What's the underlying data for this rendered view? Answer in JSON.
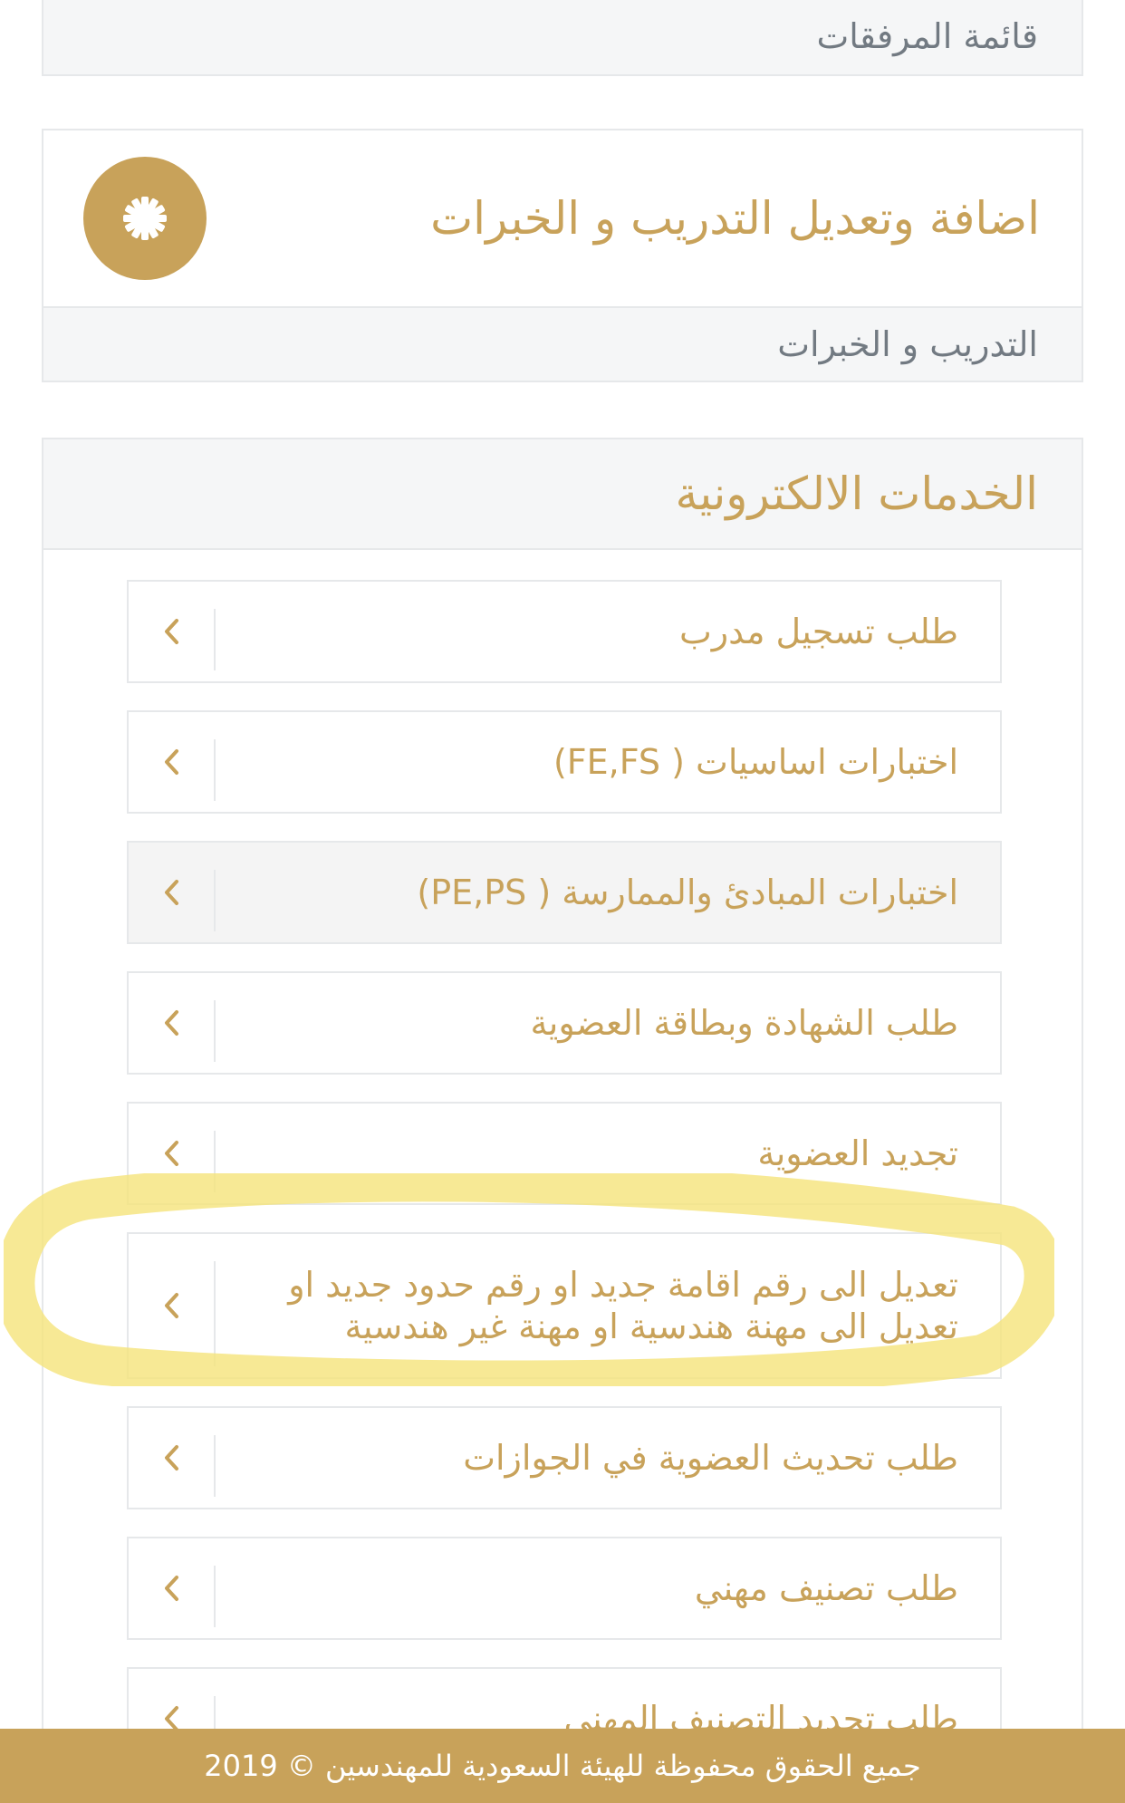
{
  "attachments": {
    "label": "قائمة المرفقات"
  },
  "training": {
    "title": "اضافة وتعديل التدريب و الخبرات",
    "subtitle": "التدريب و الخبرات",
    "icon": "gear-icon"
  },
  "eservices": {
    "title": "الخدمات الالكترونية",
    "items": [
      {
        "label": "طلب تسجيل مدرب"
      },
      {
        "label": "اختبارات اساسيات ( FE,FS)"
      },
      {
        "label": "اختبارات المبادئ والممارسة ( PE,PS)"
      },
      {
        "label": "طلب الشهادة وبطاقة العضوية"
      },
      {
        "label": "تجديد العضوية"
      },
      {
        "label_line1": "تعديل الى رقم اقامة جديد او رقم حدود جديد او",
        "label_line2": "تعديل الى مهنة هندسية او مهنة غير هندسية"
      },
      {
        "label": "طلب تحديث العضوية في الجوازات"
      },
      {
        "label": "طلب تصنيف مهني"
      },
      {
        "label": "طلب تجديد التصنيف المهني"
      }
    ]
  },
  "footer": {
    "text": "جميع الحقوق محفوظة للهيئة السعودية للمهندسين © 2019"
  },
  "colors": {
    "accent": "#c8a25a",
    "muted": "#727a82",
    "border": "#e6e8ea",
    "highlight": "#f5e37a"
  }
}
